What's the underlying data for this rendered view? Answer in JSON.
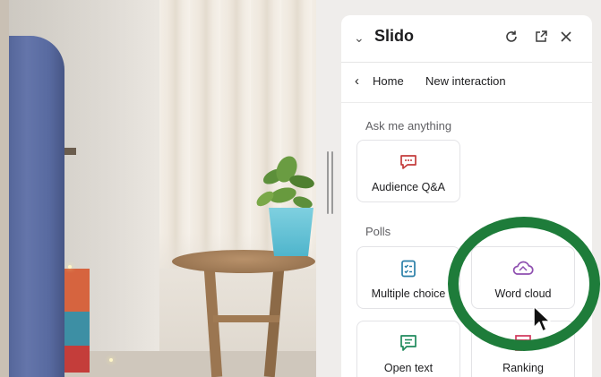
{
  "app": {
    "title": "Slido"
  },
  "panel": {
    "header": {
      "title": "Slido",
      "icons": [
        "chevron-down-icon",
        "refresh-icon",
        "popout-icon",
        "close-icon"
      ]
    },
    "nav": {
      "back_label": "Home",
      "current": "New interaction"
    },
    "sections": [
      {
        "label": "Ask me anything",
        "items": [
          {
            "label": "Audience Q&A",
            "icon": "chat-bubble-icon",
            "color": "#c43b3b"
          }
        ]
      },
      {
        "label": "Polls",
        "items": [
          {
            "label": "Multiple choice",
            "icon": "checklist-icon",
            "color": "#2a7fa8"
          },
          {
            "label": "Word cloud",
            "icon": "cloud-icon",
            "color": "#8e4fb0"
          },
          {
            "label": "Open text",
            "icon": "text-bubble-icon",
            "color": "#1f8a5c"
          },
          {
            "label": "Ranking",
            "icon": "ranking-icon",
            "color": "#d33a5f"
          }
        ]
      }
    ]
  },
  "overlay": {
    "highlight_color": "#1e7c3a"
  },
  "colors": {
    "panel_bg": "#ffffff",
    "text_primary": "#1d1d1f",
    "text_secondary": "#5f5f63"
  }
}
